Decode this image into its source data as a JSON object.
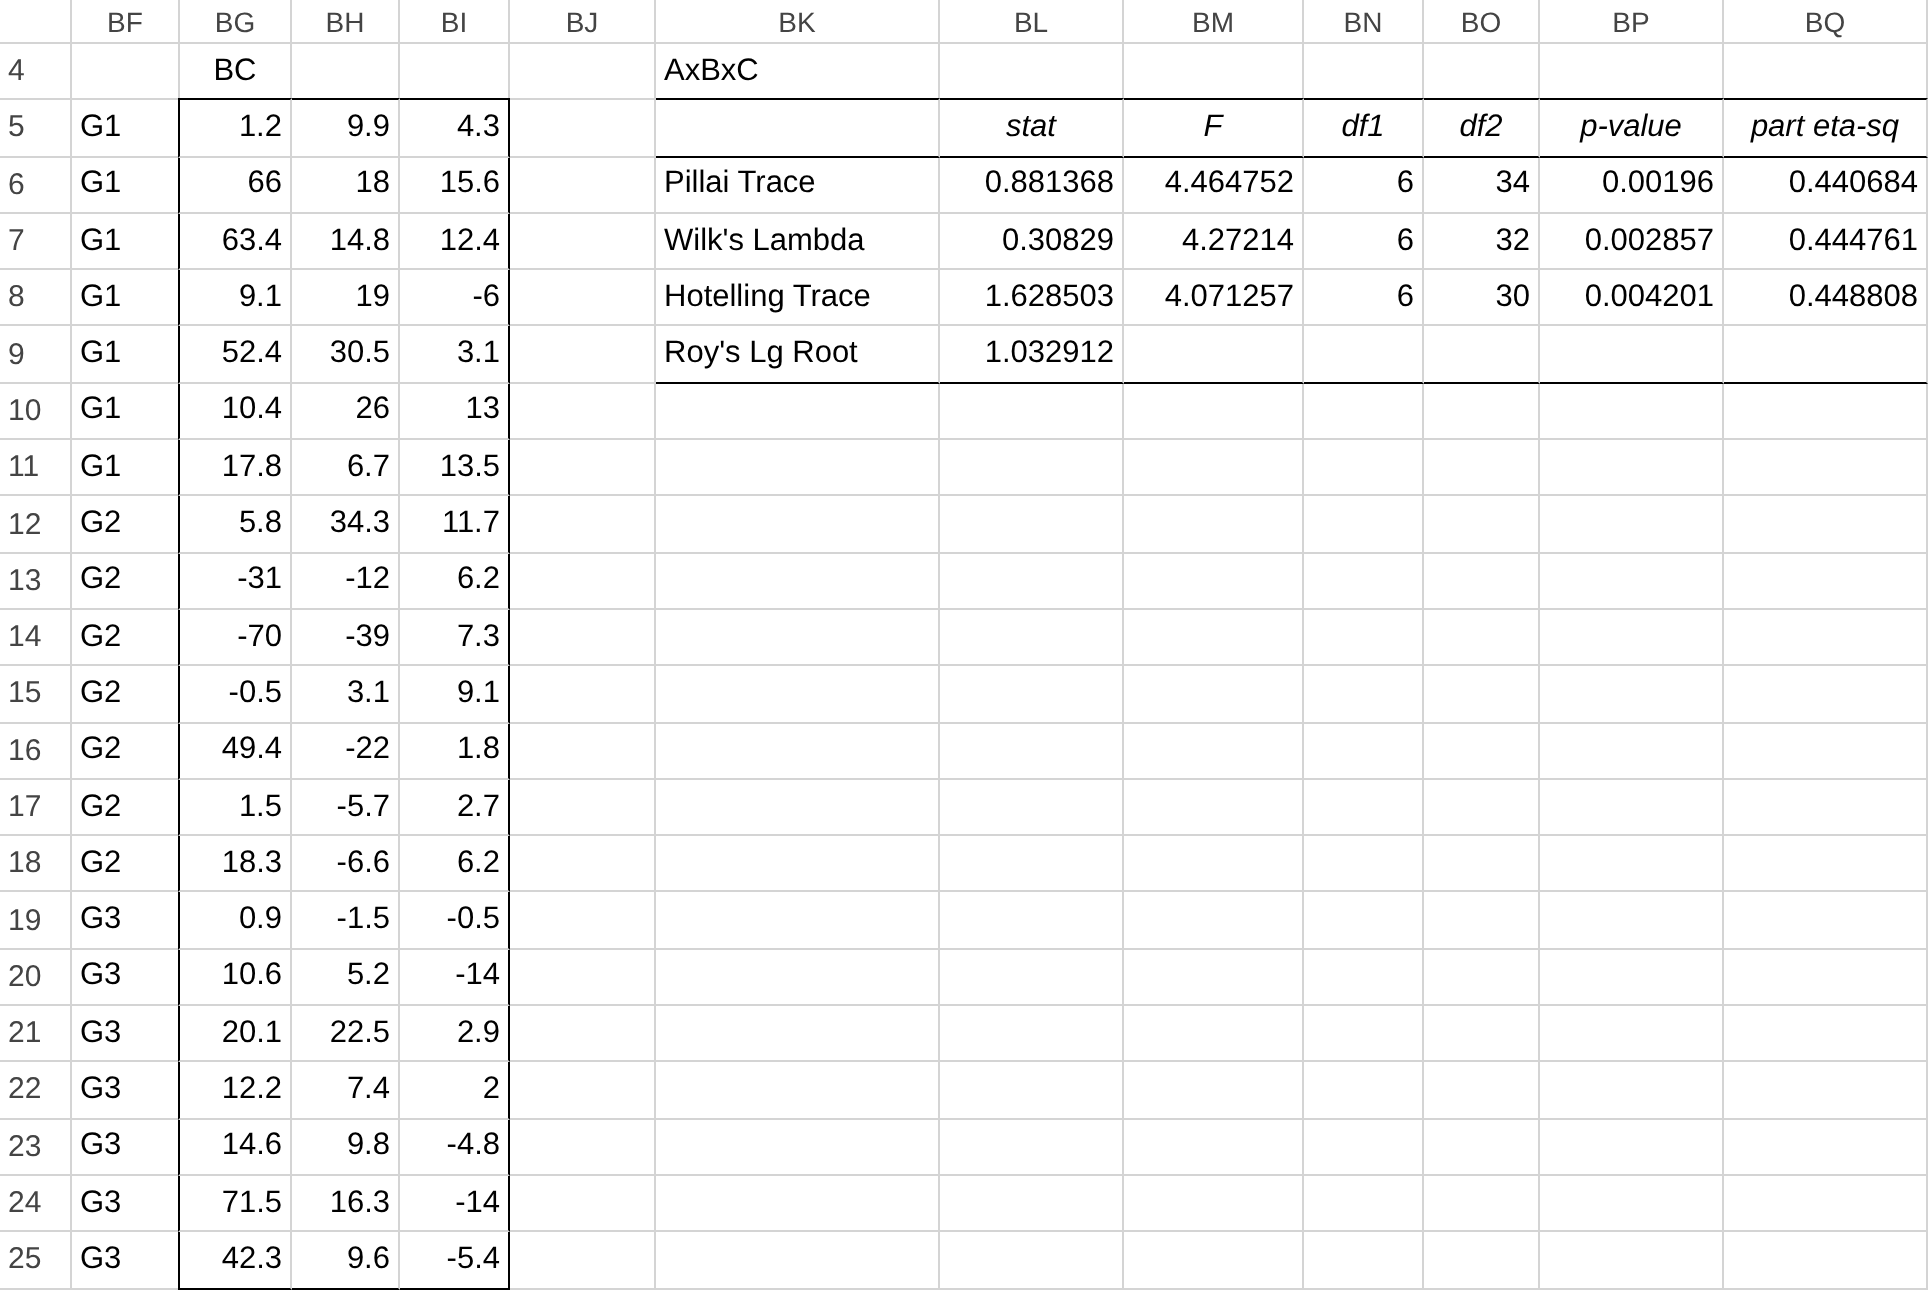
{
  "columns": [
    {
      "name": "BF",
      "kind": "text"
    },
    {
      "name": "BG",
      "kind": "number"
    },
    {
      "name": "BH",
      "kind": "number"
    },
    {
      "name": "BI",
      "kind": "number"
    },
    {
      "name": "BJ",
      "kind": "text"
    },
    {
      "name": "BK",
      "kind": "text"
    },
    {
      "name": "BL",
      "kind": "number"
    },
    {
      "name": "BM",
      "kind": "number"
    },
    {
      "name": "BN",
      "kind": "number"
    },
    {
      "name": "BO",
      "kind": "number"
    },
    {
      "name": "BP",
      "kind": "number"
    },
    {
      "name": "BQ",
      "kind": "number"
    }
  ],
  "rows": [
    {
      "number": "4",
      "kind": "caption",
      "cells": {
        "BG": "BC",
        "BK": "AxBxC"
      }
    },
    {
      "number": "5",
      "kind": "head",
      "cells": {
        "BF": "G1",
        "BG": "1.2",
        "BH": "9.9",
        "BI": "4.3",
        "BL": "stat",
        "BM": "F",
        "BN": "df1",
        "BO": "df2",
        "BP": "p-value",
        "BQ": "part eta-sq"
      }
    },
    {
      "number": "6",
      "kind": "data",
      "cells": {
        "BF": "G1",
        "BG": "66",
        "BH": "18",
        "BI": "15.6",
        "BK": "Pillai Trace",
        "BL": "0.881368",
        "BM": "4.464752",
        "BN": "6",
        "BO": "34",
        "BP": "0.00196",
        "BQ": "0.440684"
      }
    },
    {
      "number": "7",
      "kind": "data",
      "cells": {
        "BF": "G1",
        "BG": "63.4",
        "BH": "14.8",
        "BI": "12.4",
        "BK": "Wilk's Lambda",
        "BL": "0.30829",
        "BM": "4.27214",
        "BN": "6",
        "BO": "32",
        "BP": "0.002857",
        "BQ": "0.444761"
      }
    },
    {
      "number": "8",
      "kind": "data",
      "cells": {
        "BF": "G1",
        "BG": "9.1",
        "BH": "19",
        "BI": "-6",
        "BK": "Hotelling Trace",
        "BL": "1.628503",
        "BM": "4.071257",
        "BN": "6",
        "BO": "30",
        "BP": "0.004201",
        "BQ": "0.448808"
      }
    },
    {
      "number": "9",
      "kind": "data",
      "cells": {
        "BF": "G1",
        "BG": "52.4",
        "BH": "30.5",
        "BI": "3.1",
        "BK": "Roy's Lg Root",
        "BL": "1.032912"
      }
    },
    {
      "number": "10",
      "kind": "data",
      "cells": {
        "BF": "G1",
        "BG": "10.4",
        "BH": "26",
        "BI": "13"
      }
    },
    {
      "number": "11",
      "kind": "data",
      "cells": {
        "BF": "G1",
        "BG": "17.8",
        "BH": "6.7",
        "BI": "13.5"
      }
    },
    {
      "number": "12",
      "kind": "data",
      "cells": {
        "BF": "G2",
        "BG": "5.8",
        "BH": "34.3",
        "BI": "11.7"
      }
    },
    {
      "number": "13",
      "kind": "data",
      "cells": {
        "BF": "G2",
        "BG": "-31",
        "BH": "-12",
        "BI": "6.2"
      }
    },
    {
      "number": "14",
      "kind": "data",
      "cells": {
        "BF": "G2",
        "BG": "-70",
        "BH": "-39",
        "BI": "7.3"
      }
    },
    {
      "number": "15",
      "kind": "data",
      "cells": {
        "BF": "G2",
        "BG": "-0.5",
        "BH": "3.1",
        "BI": "9.1"
      }
    },
    {
      "number": "16",
      "kind": "data",
      "cells": {
        "BF": "G2",
        "BG": "49.4",
        "BH": "-22",
        "BI": "1.8"
      }
    },
    {
      "number": "17",
      "kind": "data",
      "cells": {
        "BF": "G2",
        "BG": "1.5",
        "BH": "-5.7",
        "BI": "2.7"
      }
    },
    {
      "number": "18",
      "kind": "data",
      "cells": {
        "BF": "G2",
        "BG": "18.3",
        "BH": "-6.6",
        "BI": "6.2"
      }
    },
    {
      "number": "19",
      "kind": "data",
      "cells": {
        "BF": "G3",
        "BG": "0.9",
        "BH": "-1.5",
        "BI": "-0.5"
      }
    },
    {
      "number": "20",
      "kind": "data",
      "cells": {
        "BF": "G3",
        "BG": "10.6",
        "BH": "5.2",
        "BI": "-14"
      }
    },
    {
      "number": "21",
      "kind": "data",
      "cells": {
        "BF": "G3",
        "BG": "20.1",
        "BH": "22.5",
        "BI": "2.9"
      }
    },
    {
      "number": "22",
      "kind": "data",
      "cells": {
        "BF": "G3",
        "BG": "12.2",
        "BH": "7.4",
        "BI": "2"
      }
    },
    {
      "number": "23",
      "kind": "data",
      "cells": {
        "BF": "G3",
        "BG": "14.6",
        "BH": "9.8",
        "BI": "-4.8"
      }
    },
    {
      "number": "24",
      "kind": "data",
      "cells": {
        "BF": "G3",
        "BG": "71.5",
        "BH": "16.3",
        "BI": "-14"
      }
    },
    {
      "number": "25",
      "kind": "data",
      "cells": {
        "BF": "G3",
        "BG": "42.3",
        "BH": "9.6",
        "BI": "-5.4"
      }
    }
  ]
}
